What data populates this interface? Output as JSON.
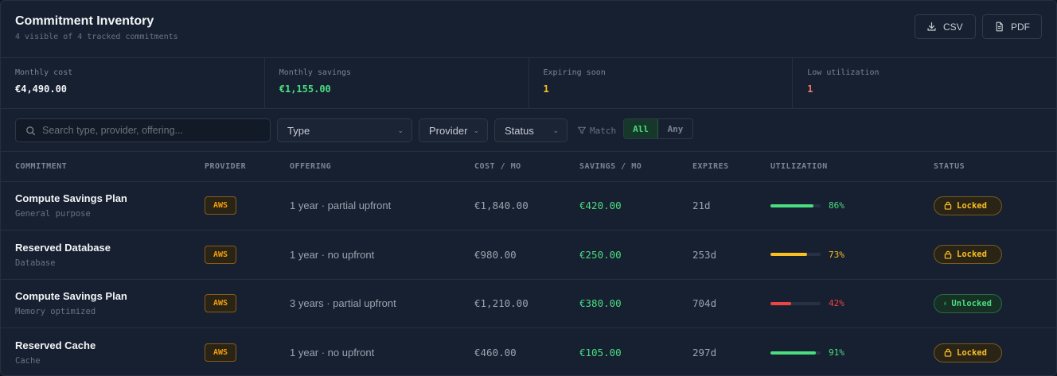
{
  "header": {
    "title": "Commitment Inventory",
    "subtitle": "4 visible of 4 tracked commitments",
    "csv_label": "CSV",
    "pdf_label": "PDF"
  },
  "stats": [
    {
      "label": "Monthly cost",
      "value": "€4,490.00",
      "color": "#f3f4f6"
    },
    {
      "label": "Monthly savings",
      "value": "€1,155.00",
      "color": "#4ade80"
    },
    {
      "label": "Expiring soon",
      "value": "1",
      "color": "#fbbf24"
    },
    {
      "label": "Low utilization",
      "value": "1",
      "color": "#f87171"
    }
  ],
  "filters": {
    "search_placeholder": "Search type, provider, offering...",
    "type_label": "Type",
    "provider_label": "Provider",
    "status_label": "Status",
    "match_label": "Match",
    "match_all": "All",
    "match_any": "Any"
  },
  "table": {
    "columns": [
      "COMMITMENT",
      "PROVIDER",
      "OFFERING",
      "COST / MO",
      "SAVINGS / MO",
      "EXPIRES",
      "UTILIZATION",
      "STATUS"
    ],
    "rows": [
      {
        "name": "Compute Savings Plan",
        "sub": "General purpose",
        "provider": "AWS",
        "offering": "1 year · partial upfront",
        "cost": "€1,840.00",
        "savings": "€420.00",
        "expires": "21d",
        "utilization": 86,
        "util_text": "86%",
        "util_color": "#4ade80",
        "status": "Locked"
      },
      {
        "name": "Reserved Database",
        "sub": "Database",
        "provider": "AWS",
        "offering": "1 year · no upfront",
        "cost": "€980.00",
        "savings": "€250.00",
        "expires": "253d",
        "utilization": 73,
        "util_text": "73%",
        "util_color": "#fbbf24",
        "status": "Locked"
      },
      {
        "name": "Compute Savings Plan",
        "sub": "Memory optimized",
        "provider": "AWS",
        "offering": "3 years · partial upfront",
        "cost": "€1,210.00",
        "savings": "€380.00",
        "expires": "704d",
        "utilization": 42,
        "util_text": "42%",
        "util_color": "#ef4444",
        "status": "Unlocked"
      },
      {
        "name": "Reserved Cache",
        "sub": "Cache",
        "provider": "AWS",
        "offering": "1 year · no upfront",
        "cost": "€460.00",
        "savings": "€105.00",
        "expires": "297d",
        "utilization": 91,
        "util_text": "91%",
        "util_color": "#4ade80",
        "status": "Locked"
      }
    ]
  }
}
